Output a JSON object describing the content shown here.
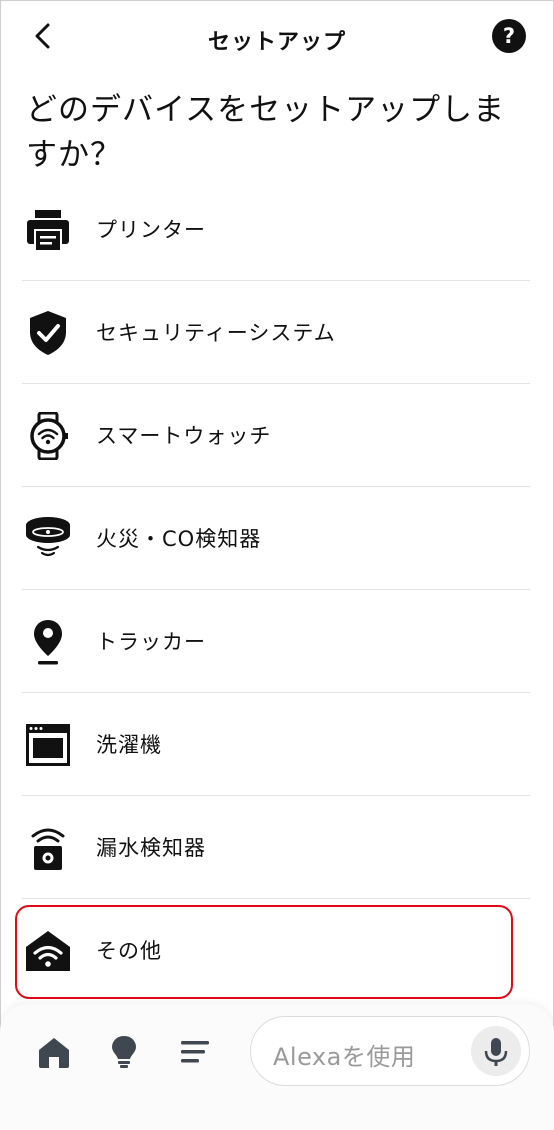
{
  "header": {
    "title": "セットアップ",
    "back_icon": "chevron-left-icon",
    "help_icon": "question-circle-icon"
  },
  "question": "どのデバイスをセットアップしますか？",
  "devices": [
    {
      "label": "プリンター",
      "icon": "printer-icon"
    },
    {
      "label": "セキュリティーシステム",
      "icon": "shield-check-icon"
    },
    {
      "label": "スマートウォッチ",
      "icon": "smartwatch-icon"
    },
    {
      "label": "火災・CO検知器",
      "icon": "smoke-detector-icon"
    },
    {
      "label": "トラッカー",
      "icon": "location-pin-icon"
    },
    {
      "label": "洗濯機",
      "icon": "washer-icon"
    },
    {
      "label": "漏水検知器",
      "icon": "leak-detector-icon"
    },
    {
      "label": "その他",
      "icon": "wifi-home-icon"
    }
  ],
  "bottom_nav": {
    "home_icon": "home-icon",
    "bulb_icon": "lightbulb-icon",
    "menu_icon": "menu-lines-icon",
    "alexa_placeholder": "Alexaを使用",
    "mic_icon": "microphone-icon"
  },
  "colors": {
    "highlight": "#e00a16",
    "icon": "#111111",
    "divider": "#e3e3e3"
  }
}
